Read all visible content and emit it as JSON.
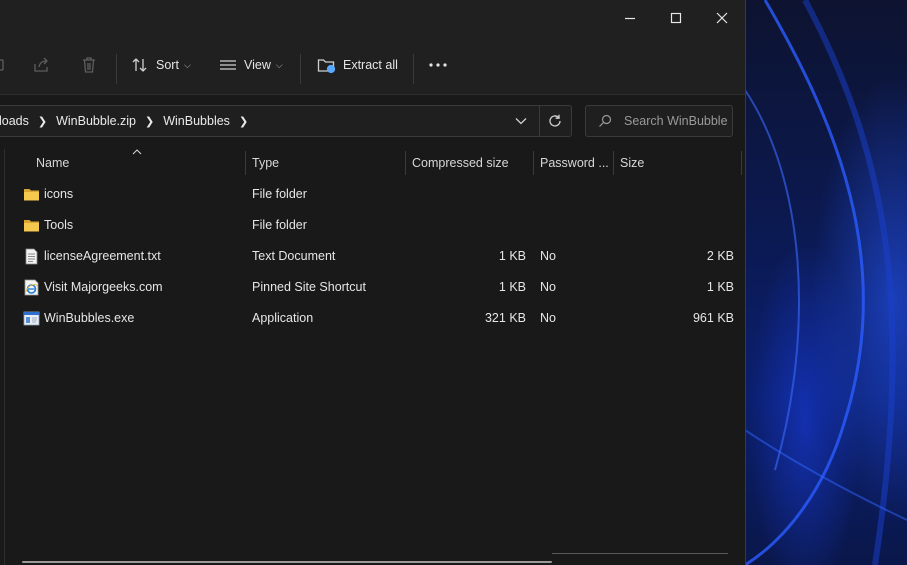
{
  "window": {
    "caption": {
      "minimize": "minimize",
      "maximize": "maximize",
      "close": "close"
    }
  },
  "toolbar": {
    "sort_label": "Sort",
    "view_label": "View",
    "extract_label": "Extract all",
    "more_label": "..."
  },
  "address": {
    "crumbs": [
      "loads",
      "WinBubble.zip",
      "WinBubbles"
    ],
    "search_placeholder": "Search WinBubbles"
  },
  "columns": {
    "name": "Name",
    "type": "Type",
    "compressed": "Compressed size",
    "password": "Password ...",
    "size": "Size"
  },
  "files": [
    {
      "name": "icons",
      "type": "File folder",
      "compressed": "",
      "password": "",
      "size": "",
      "icon": "folder-icon"
    },
    {
      "name": "Tools",
      "type": "File folder",
      "compressed": "",
      "password": "",
      "size": "",
      "icon": "folder-icon"
    },
    {
      "name": "licenseAgreement.txt",
      "type": "Text Document",
      "compressed": "1 KB",
      "password": "No",
      "size": "2 KB",
      "icon": "text-file-icon"
    },
    {
      "name": "Visit Majorgeeks.com",
      "type": "Pinned Site Shortcut",
      "compressed": "1 KB",
      "password": "No",
      "size": "1 KB",
      "icon": "internet-shortcut-icon"
    },
    {
      "name": "WinBubbles.exe",
      "type": "Application",
      "compressed": "321 KB",
      "password": "No",
      "size": "961 KB",
      "icon": "application-icon"
    }
  ],
  "colors": {
    "background": "#191919",
    "toolbar": "#202020",
    "folder": "#f2c14e",
    "wallpaper_accent": "#1f4fff"
  }
}
